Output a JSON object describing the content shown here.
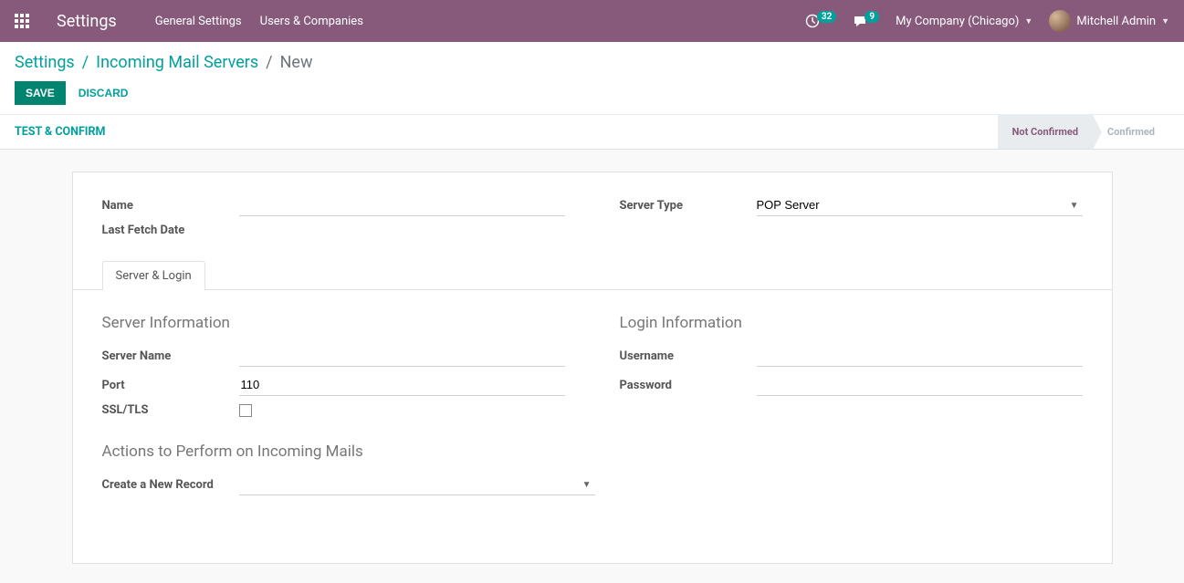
{
  "nav": {
    "brand": "Settings",
    "menu": [
      "General Settings",
      "Users & Companies"
    ],
    "clock_badge": "32",
    "chat_badge": "9",
    "company": "My Company (Chicago)",
    "user": "Mitchell Admin"
  },
  "breadcrumb": {
    "items": [
      "Settings",
      "Incoming Mail Servers"
    ],
    "current": "New"
  },
  "buttons": {
    "save": "Save",
    "discard": "Discard",
    "test_confirm": "Test & Confirm"
  },
  "status": {
    "not_confirmed": "Not Confirmed",
    "confirmed": "Confirmed"
  },
  "form": {
    "name_label": "Name",
    "name_value": "",
    "last_fetch_label": "Last Fetch Date",
    "server_type_label": "Server Type",
    "server_type_value": "POP Server",
    "tab_server_login": "Server & Login",
    "server_info_title": "Server Information",
    "server_name_label": "Server Name",
    "server_name_value": "",
    "port_label": "Port",
    "port_value": "110",
    "ssl_label": "SSL/TLS",
    "login_info_title": "Login Information",
    "username_label": "Username",
    "username_value": "",
    "password_label": "Password",
    "password_value": "",
    "actions_title": "Actions to Perform on Incoming Mails",
    "create_record_label": "Create a New Record",
    "create_record_value": ""
  }
}
